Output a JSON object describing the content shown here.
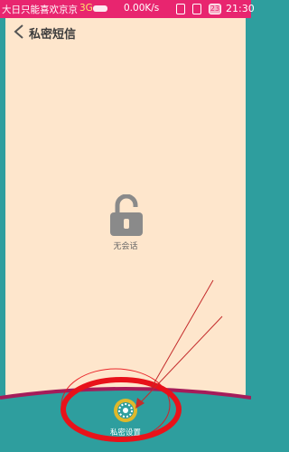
{
  "status_bar": {
    "carrier_text": "大日只能喜欢京京",
    "network": "3G",
    "speed": "0.00K/s",
    "badge": "23",
    "time": "21:30"
  },
  "header": {
    "back_icon": "chevron-left-icon",
    "title": "私密短信"
  },
  "main": {
    "empty_icon": "unlock-icon",
    "empty_text": "无会话"
  },
  "bottom": {
    "settings_icon": "gear-icon",
    "settings_label": "私密设置"
  },
  "colors": {
    "status_bar": "#e8256f",
    "background": "#fee6cc",
    "footer": "#2e9e9e",
    "annotation": "#e8121a"
  }
}
